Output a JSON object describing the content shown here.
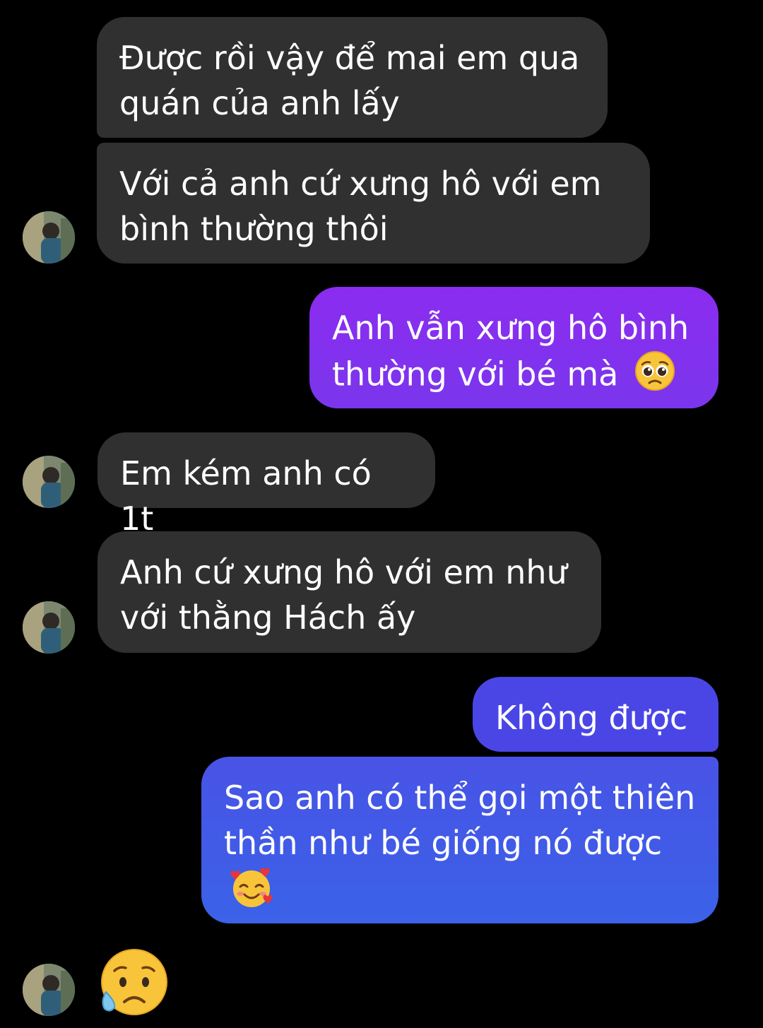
{
  "messages": [
    {
      "text": "Được rồi vậy để mai em qua quán của anh lấy"
    },
    {
      "text": "Với cả anh cứ xưng hô với em bình thường thôi"
    },
    {
      "text": "Anh vẫn xưng hô bình thường với bé mà",
      "emoji": "pleading-face-icon"
    },
    {
      "text": "Em kém anh có 1t"
    },
    {
      "text": "Anh cứ xưng hô với em như với thằng Hách ấy"
    },
    {
      "text": "Không được"
    },
    {
      "text": "Sao anh có thể gọi một thiên thần như bé giống nó được",
      "emoji": "smiling-face-with-hearts-icon"
    },
    {
      "emoji": "sad-but-relieved-face-icon"
    }
  ],
  "colors": {
    "background": "#000000",
    "incoming_bubble": "#303030",
    "outgoing_purple": "#7f33ee",
    "outgoing_blue": "#4a46e6"
  }
}
